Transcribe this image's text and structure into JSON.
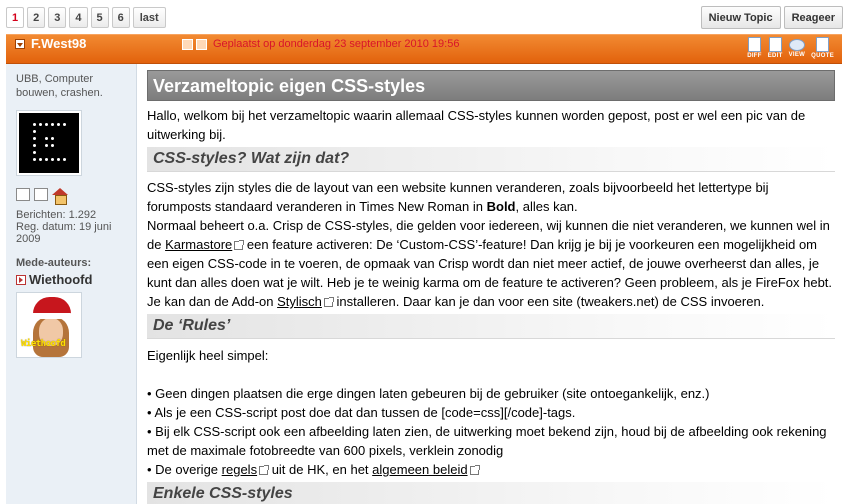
{
  "pagination": {
    "pages": [
      "1",
      "2",
      "3",
      "4",
      "5",
      "6"
    ],
    "current": "1",
    "last_label": "last"
  },
  "actions": {
    "new_topic": "Nieuw Topic",
    "reply": "Reageer"
  },
  "post_header": {
    "author": "F.West98",
    "date": "Geplaatst op donderdag 23 september 2010 19:56",
    "tools": [
      "DIFF",
      "EDIT",
      "VIEW",
      "QUOTE"
    ]
  },
  "sidebar": {
    "user_title": "UBB, Computer bouwen, crashen.",
    "posts": "Berichten: 1.292",
    "reg_date": "Reg. datum: 19 juni 2009",
    "coauthors_label": "Mede-auteurs:",
    "coauthor_name": "Wiethoofd",
    "coauthor_avatar_text": "Wiethoofd"
  },
  "post": {
    "title": "Verzameltopic eigen CSS-styles",
    "intro": "Hallo, welkom bij het verzameltopic waarin allemaal CSS-styles kunnen worden gepost, post er wel een pic van de uitwerking bij.",
    "h1": "CSS-styles? Wat zijn dat?",
    "p1a": "CSS-styles zijn styles die de layout van een website kunnen veranderen, zoals bijvoorbeeld het lettertype bij forumposts standaard veranderen in Times New Roman in ",
    "p1_bold": "Bold",
    "p1b": ", alles kan.",
    "p2a": "Normaal beheert o.a. Crisp de CSS-styles, die gelden voor iedereen, wij kunnen die niet veranderen, we kunnen wel in de ",
    "p2_link": "Karmastore",
    "p2b": " een feature activeren: De ‘Custom-CSS’-feature! Dan krijg je bij je voorkeuren een mogelijkheid om een eigen CSS-code in te voeren, de opmaak van Crisp wordt dan niet meer actief, de jouwe overheerst dan alles, je kunt dan alles doen wat je wilt. Heb je te weinig karma om de feature te activeren? Geen probleem, als je FireFox hebt. Je kan dan de Add-on ",
    "p2_link2": "Stylisch",
    "p2c": " installeren. Daar kan je dan voor een site (tweakers.net) de CSS invoeren.",
    "h2": "De ‘Rules’",
    "p3": "Eigenlijk heel simpel:",
    "b1": "• Geen dingen plaatsen die erge dingen laten gebeuren bij de gebruiker (site ontoegankelijk, enz.)",
    "b2": "• Als je een CSS-script post doe dat dan tussen de [code=css][/code]-tags.",
    "b3": "• Bij elk CSS-script ook een afbeelding laten zien, de uitwerking moet bekend zijn, houd bij de afbeelding ook rekening met de maximale fotobreedte van 600 pixels, verklein zonodig",
    "b4a": "• De overige ",
    "b4_link1": "regels",
    "b4b": " uit de HK, en het ",
    "b4_link2": "algemeen beleid",
    "h3": "Enkele CSS-styles"
  }
}
